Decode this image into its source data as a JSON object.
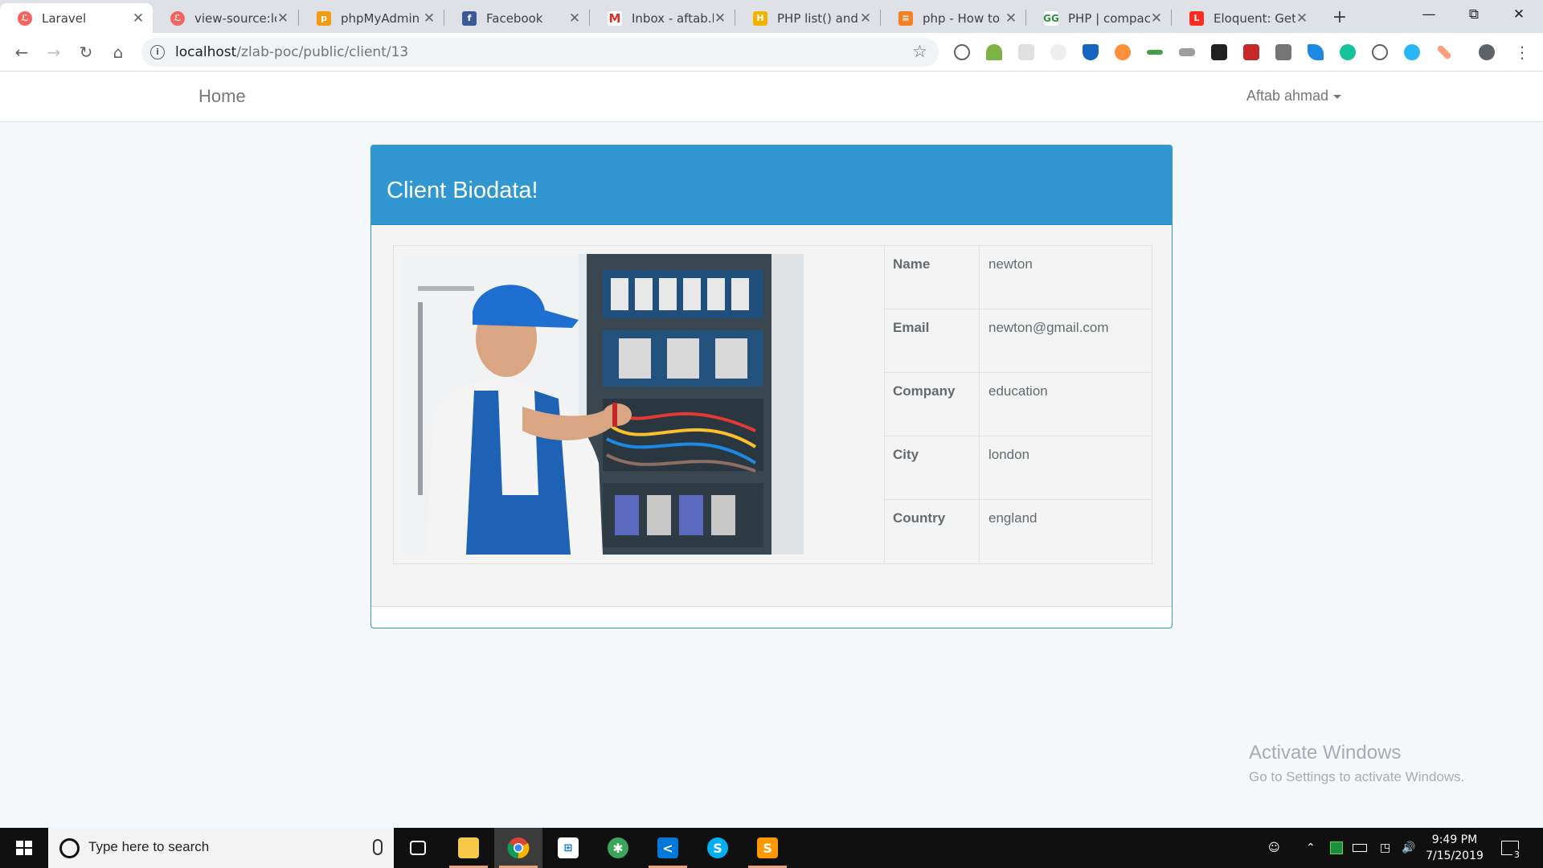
{
  "browser": {
    "tabs": [
      {
        "title": "Laravel",
        "favicon": "laravel-icon",
        "color": "#f4645f",
        "active": true
      },
      {
        "title": "view-source:loc",
        "favicon": "laravel-icon",
        "color": "#f4645f",
        "active": false
      },
      {
        "title": "phpMyAdmin",
        "favicon": "phpmyadmin-icon",
        "color": "#f39c12",
        "active": false
      },
      {
        "title": "Facebook",
        "favicon": "facebook-icon",
        "color": "#3b5998",
        "active": false
      },
      {
        "title": "Inbox - aftab.bt",
        "favicon": "gmail-icon",
        "color": "#d93025",
        "active": false
      },
      {
        "title": "PHP list() and S",
        "favicon": "hackr-icon",
        "color": "#f0b400",
        "active": false
      },
      {
        "title": "php - How to k",
        "favicon": "stackoverflow-icon",
        "color": "#f48024",
        "active": false
      },
      {
        "title": "PHP | compact(",
        "favicon": "geeksforgeeks-icon",
        "color": "#2f8d46",
        "active": false
      },
      {
        "title": "Eloquent: Getti",
        "favicon": "laravel-icon",
        "color": "#ff2d20",
        "active": false
      }
    ],
    "new_tab_label": "+",
    "url_host": "localhost",
    "url_path": "/zlab-poc/public/client/13"
  },
  "navbar": {
    "brand": "Home",
    "user_name": "Aftab ahmad"
  },
  "panel": {
    "title": "Client Biodata!",
    "fields": [
      {
        "label": "Name",
        "value": "newton"
      },
      {
        "label": "Email",
        "value": "newton@gmail.com"
      },
      {
        "label": "Company",
        "value": "education"
      },
      {
        "label": "City",
        "value": "london"
      },
      {
        "label": "Country",
        "value": "england"
      }
    ]
  },
  "watermark": {
    "line1": "Activate Windows",
    "line2": "Go to Settings to activate Windows."
  },
  "taskbar": {
    "search_placeholder": "Type here to search",
    "time": "9:49 PM",
    "date": "7/15/2019",
    "notification_count": "3"
  },
  "colors": {
    "accent": "#3097d1",
    "panel_body": "#f4f4f4",
    "text": "#636b6f"
  }
}
